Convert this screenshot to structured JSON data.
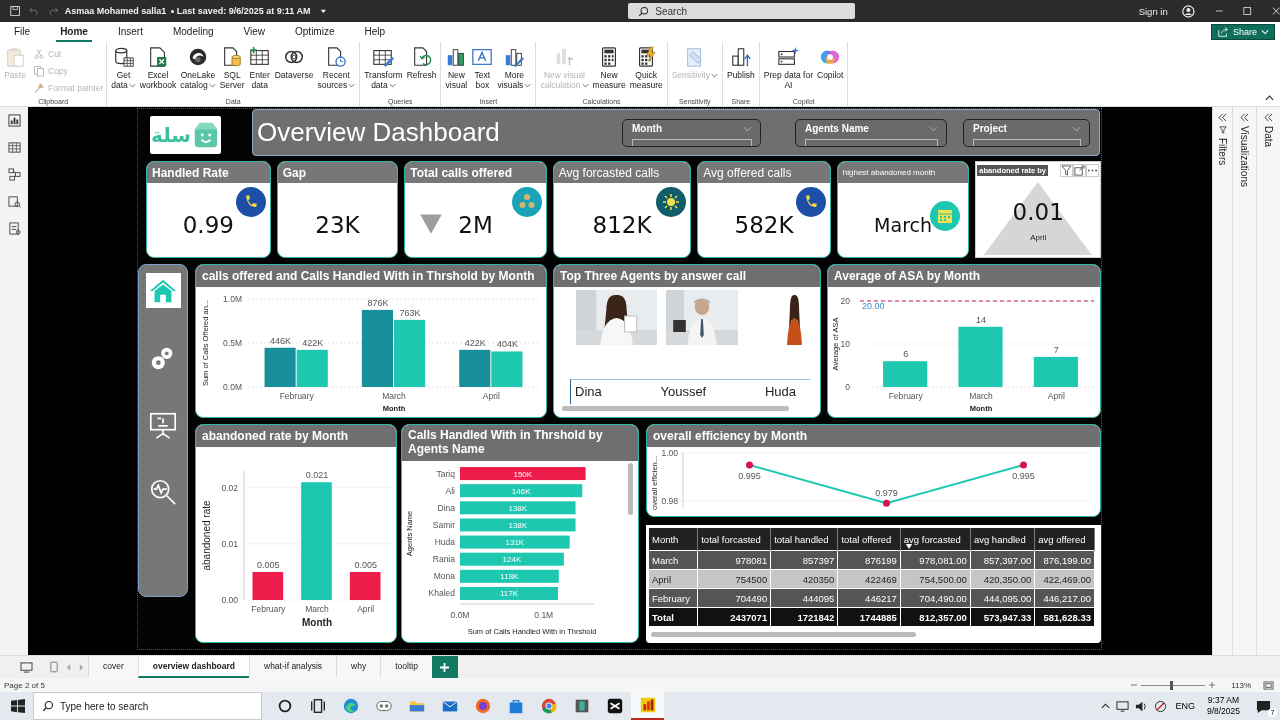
{
  "title_bar": {
    "file_name": "Asmaa Mohamed salla1",
    "saved": "Last saved: 9/6/2025 at 9:11 AM",
    "search": {
      "placeholder": "Search"
    },
    "sign_in": "Sign in"
  },
  "ribbon_tabs": [
    {
      "label": "File",
      "selected": false
    },
    {
      "label": "Home",
      "selected": true
    },
    {
      "label": "Insert",
      "selected": false
    },
    {
      "label": "Modeling",
      "selected": false
    },
    {
      "label": "View",
      "selected": false
    },
    {
      "label": "Optimize",
      "selected": false
    },
    {
      "label": "Help",
      "selected": false
    }
  ],
  "share_button": "Share",
  "ribbon_groups": [
    {
      "label": "Clipboard",
      "items": [
        {
          "kind": "large",
          "lines": [
            "Paste"
          ],
          "disabled": true,
          "dropdown": false
        },
        {
          "kind": "small",
          "lines": [
            "Cut"
          ],
          "disabled": true,
          "dropdown": false
        },
        {
          "kind": "small",
          "lines": [
            "Copy"
          ],
          "disabled": true,
          "dropdown": false
        },
        {
          "kind": "small",
          "lines": [
            "Format painter"
          ],
          "disabled": true,
          "dropdown": false
        }
      ]
    },
    {
      "label": "Data",
      "items": [
        {
          "kind": "large",
          "lines": [
            "Get",
            "data"
          ],
          "disabled": false,
          "dropdown": true
        },
        {
          "kind": "large",
          "lines": [
            "Excel",
            "workbook"
          ],
          "disabled": false,
          "dropdown": false
        },
        {
          "kind": "large",
          "lines": [
            "OneLake",
            "catalog"
          ],
          "disabled": false,
          "dropdown": true
        },
        {
          "kind": "large",
          "lines": [
            "SQL",
            "Server"
          ],
          "disabled": false,
          "dropdown": false
        },
        {
          "kind": "large",
          "lines": [
            "Enter",
            "data"
          ],
          "disabled": false,
          "dropdown": false
        },
        {
          "kind": "large",
          "lines": [
            "Dataverse"
          ],
          "disabled": false,
          "dropdown": false
        },
        {
          "kind": "large",
          "lines": [
            "Recent",
            "sources"
          ],
          "disabled": false,
          "dropdown": true
        }
      ]
    },
    {
      "label": "Queries",
      "items": [
        {
          "kind": "large",
          "lines": [
            "Transform",
            "data"
          ],
          "disabled": false,
          "dropdown": true
        },
        {
          "kind": "large",
          "lines": [
            "Refresh"
          ],
          "disabled": false,
          "dropdown": false
        }
      ]
    },
    {
      "label": "Insert",
      "items": [
        {
          "kind": "large",
          "lines": [
            "New",
            "visual"
          ],
          "disabled": false,
          "dropdown": false
        },
        {
          "kind": "large",
          "lines": [
            "Text",
            "box"
          ],
          "disabled": false,
          "dropdown": false
        },
        {
          "kind": "large",
          "lines": [
            "More",
            "visuals"
          ],
          "disabled": false,
          "dropdown": true
        }
      ]
    },
    {
      "label": "Calculations",
      "items": [
        {
          "kind": "large",
          "lines": [
            "New visual",
            "calculation"
          ],
          "disabled": true,
          "dropdown": true
        },
        {
          "kind": "large",
          "lines": [
            "New",
            "measure"
          ],
          "disabled": false,
          "dropdown": false
        },
        {
          "kind": "large",
          "lines": [
            "Quick",
            "measure"
          ],
          "disabled": false,
          "dropdown": false
        }
      ]
    },
    {
      "label": "Sensitivity",
      "items": [
        {
          "kind": "large",
          "lines": [
            "Sensitivity"
          ],
          "disabled": true,
          "dropdown": true
        }
      ]
    },
    {
      "label": "Share",
      "items": [
        {
          "kind": "large",
          "lines": [
            "Publish"
          ],
          "disabled": false,
          "dropdown": false
        }
      ]
    },
    {
      "label": "Copilot",
      "items": [
        {
          "kind": "large",
          "lines": [
            "Prep data for",
            "AI"
          ],
          "disabled": false,
          "dropdown": false
        },
        {
          "kind": "large",
          "lines": [
            "Copilot"
          ],
          "disabled": false,
          "dropdown": false
        }
      ]
    }
  ],
  "right_panes": [
    "Filters",
    "Visualizations",
    "Data"
  ],
  "dashboard": {
    "logo": "سلة",
    "title": "Overview Dashboard",
    "slicers": [
      {
        "label": "Month"
      },
      {
        "label": "Agents Name"
      },
      {
        "label": "Project"
      }
    ],
    "kpis": [
      {
        "title": "Handled Rate",
        "value": "0.99"
      },
      {
        "title": "Gap",
        "value": "23K"
      },
      {
        "title": "Total calls offered",
        "value": "2M",
        "trend_down": true
      },
      {
        "title": "Avg forcasted calls",
        "value": "812K"
      },
      {
        "title": "Avg offered calls",
        "value": "582K"
      },
      {
        "title": "highest abandoned month",
        "value": "March"
      },
      {
        "title": "abandoned rate by",
        "value": "0.01",
        "subtitle": "April"
      }
    ],
    "nav_buttons": [
      {
        "selected": true
      },
      {
        "selected": false
      },
      {
        "selected": false
      },
      {
        "selected": false
      }
    ],
    "calls_chart": {
      "title": "calls offered and Calls Handled With in Thrshold by Month",
      "chart_data": {
        "type": "bar",
        "xlabel": "Month",
        "ylabel": "Sum of Calls Offered an...",
        "categories": [
          "February",
          "March",
          "April"
        ],
        "series": [
          {
            "color": "#1a8f9c",
            "values": [
              446000,
              876000,
              422000
            ]
          },
          {
            "color": "#1ec8b0",
            "values": [
              422000,
              763000,
              404000
            ]
          }
        ],
        "ylim": [
          0,
          1000000
        ],
        "yticks": [
          {
            "value": 0,
            "label": "0.0M"
          },
          {
            "value": 500000,
            "label": "0.5M"
          },
          {
            "value": 1000000,
            "label": "1.0M"
          }
        ],
        "value_labels": [
          [
            "446K",
            "876K",
            "422K"
          ],
          [
            "422K",
            "763K",
            "404K"
          ]
        ]
      }
    },
    "agents_panel": {
      "title": "Top Three Agents by answer call",
      "agents": [
        {
          "name": "Dina"
        },
        {
          "name": "Youssef"
        },
        {
          "name": "Huda"
        }
      ]
    },
    "asa_chart": {
      "title": "Average of ASA by Month",
      "chart_data": {
        "type": "bar",
        "xlabel": "Month",
        "ylabel": "Average of ASA",
        "categories": [
          "February",
          "March",
          "April"
        ],
        "series": [
          {
            "color": "#1ec8b0",
            "values": [
              6,
              14,
              7
            ]
          }
        ],
        "ylim": [
          0,
          20
        ],
        "yticks": [
          0,
          10,
          20
        ],
        "value_labels": [
          [
            "6",
            "14",
            "7"
          ]
        ],
        "ref_lines": [
          {
            "label": "20.00"
          }
        ]
      }
    },
    "abandoned_chart": {
      "title": "abandoned rate by Month",
      "chart_data": {
        "type": "bar",
        "xlabel": "Month",
        "ylabel": "abandoned rate",
        "categories": [
          "February",
          "March",
          "April"
        ],
        "series": [
          {
            "values": [
              0.005,
              0.021,
              0.005
            ],
            "colors": [
              "#ee1c4a",
              "#1ec8b0",
              "#ee1c4a"
            ]
          }
        ],
        "ylim": [
          0,
          0.023
        ],
        "yticks": [
          {
            "value": 0,
            "label": "0.00"
          },
          {
            "value": 0.01,
            "label": "0.01"
          },
          {
            "value": 0.02,
            "label": "0.02"
          }
        ],
        "value_labels": [
          [
            "0.005",
            "0.021",
            "0.005"
          ]
        ]
      }
    },
    "agents_chart": {
      "title": "Calls Handled With in Thrshold by Agents Name",
      "chart_data": {
        "type": "bar",
        "orientation": "horizontal",
        "xlabel": "Sum of Calls Handled With in Thrshold",
        "ylabel": "Agents Name",
        "categories": [
          "Tariq",
          "Ali",
          "Dina",
          "Samir",
          "Huda",
          "Rania",
          "Mona",
          "Khaled"
        ],
        "series": [
          {
            "values": [
              150000,
              146000,
              138000,
              138000,
              131000,
              124000,
              118000,
              117000
            ],
            "colors": [
              "#ee1c4a",
              "#1ec8b0",
              "#1ec8b0",
              "#1ec8b0",
              "#1ec8b0",
              "#1ec8b0",
              "#1ec8b0",
              "#1ec8b0"
            ]
          }
        ],
        "xlim": [
          0,
          160000
        ],
        "xticks": [
          {
            "value": 0,
            "label": "0.0M"
          },
          {
            "value": 100000,
            "label": "0.1M"
          }
        ],
        "value_labels": [
          [
            "150K",
            "146K",
            "138K",
            "138K",
            "131K",
            "124K",
            "118K",
            "117K"
          ]
        ]
      }
    },
    "efficiency_chart": {
      "title": "overall efficiency by Month",
      "chart_data": {
        "type": "line",
        "ylabel": "overall efficien...",
        "series": [
          {
            "color": "#1ec8b0",
            "marker": true,
            "values": [
              0.995,
              0.979,
              0.995
            ]
          }
        ],
        "ylim": [
          0.977,
          1.0
        ],
        "yticks": [
          {
            "value": 0.98,
            "label": "0.98"
          },
          {
            "value": 1.0,
            "label": "1.00"
          }
        ],
        "value_labels": [
          [
            "0.995",
            "0.979",
            "0.995"
          ]
        ]
      }
    },
    "table": {
      "columns": [
        {
          "label": "Month",
          "sorted": false
        },
        {
          "label": "total forcasted",
          "sorted": false
        },
        {
          "label": "total handled",
          "sorted": false
        },
        {
          "label": "total offered",
          "sorted": false
        },
        {
          "label": "avg forcasted",
          "sorted": true
        },
        {
          "label": "avg handled",
          "sorted": false
        },
        {
          "label": "avg offered",
          "sorted": false
        }
      ],
      "rows": [
        [
          "March",
          "978081",
          "857397",
          "876199",
          "978,081.00",
          "857,397.00",
          "876,199.00"
        ],
        [
          "April",
          "754500",
          "420350",
          "422469",
          "754,500.00",
          "420,350.00",
          "422,469.00"
        ],
        [
          "February",
          "704490",
          "444095",
          "446217",
          "704,490.00",
          "444,095.00",
          "446,217.00"
        ]
      ],
      "total": [
        "Total",
        "2437071",
        "1721842",
        "1744885",
        "812,357.00",
        "573,947.33",
        "581,628.33"
      ]
    }
  },
  "page_tabs": [
    {
      "label": "cover",
      "selected": false
    },
    {
      "label": "overview dashboard",
      "selected": true
    },
    {
      "label": "what-if analysis",
      "selected": false
    },
    {
      "label": "why",
      "selected": false
    },
    {
      "label": "tooltip",
      "selected": false
    }
  ],
  "status_bar": {
    "page": "Page 2 of 5",
    "zoom": {
      "level": 0.46,
      "reading": "113%"
    }
  },
  "taskbar": {
    "search": {
      "placeholder": "Type here to search"
    },
    "language": "ENG",
    "time": "9:37 AM",
    "date": "9/8/2025",
    "notifications": "7"
  }
}
